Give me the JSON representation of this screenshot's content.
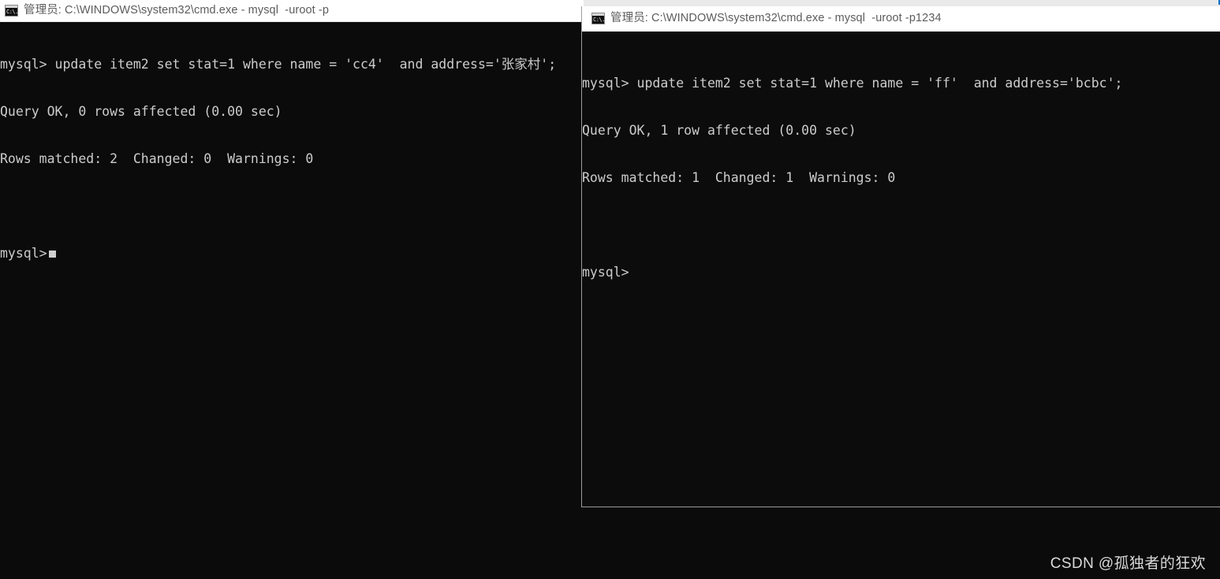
{
  "desktop": {
    "background_color": "#0b0b0b",
    "watermark": "CSDN @孤独者的狂欢"
  },
  "top_tab_strip": {
    "active_tab_color": "#0a76c8",
    "strip_color": "#eaeaea"
  },
  "windows": [
    {
      "id": "window-back",
      "icon_name": "cmd-console-icon",
      "icon_glyph": "C:\\.",
      "title": "管理员: C:\\WINDOWS\\system32\\cmd.exe - mysql  -uroot -p",
      "focused": false,
      "console": {
        "background_color": "#0b0b0b",
        "text_color": "#cccccc",
        "lines": [
          "mysql> update item2 set stat=1 where name = 'cc4'  and address='张家村';",
          "Query OK, 0 rows affected (0.00 sec)",
          "Rows matched: 2  Changed: 0  Warnings: 0",
          "",
          "mysql>"
        ],
        "prompt": "mysql>",
        "cursor_visible": true
      }
    },
    {
      "id": "window-front",
      "icon_name": "cmd-console-icon",
      "icon_glyph": "C:\\.",
      "title": "管理员: C:\\WINDOWS\\system32\\cmd.exe - mysql  -uroot -p1234",
      "focused": true,
      "console": {
        "background_color": "#0c0c0c",
        "text_color": "#cccccc",
        "lines": [
          "mysql> update item2 set stat=1 where name = 'ff'  and address='bcbc';",
          "Query OK, 1 row affected (0.00 sec)",
          "Rows matched: 1  Changed: 1  Warnings: 0",
          "",
          "mysql>"
        ],
        "prompt": "mysql>",
        "cursor_visible": false
      }
    }
  ]
}
